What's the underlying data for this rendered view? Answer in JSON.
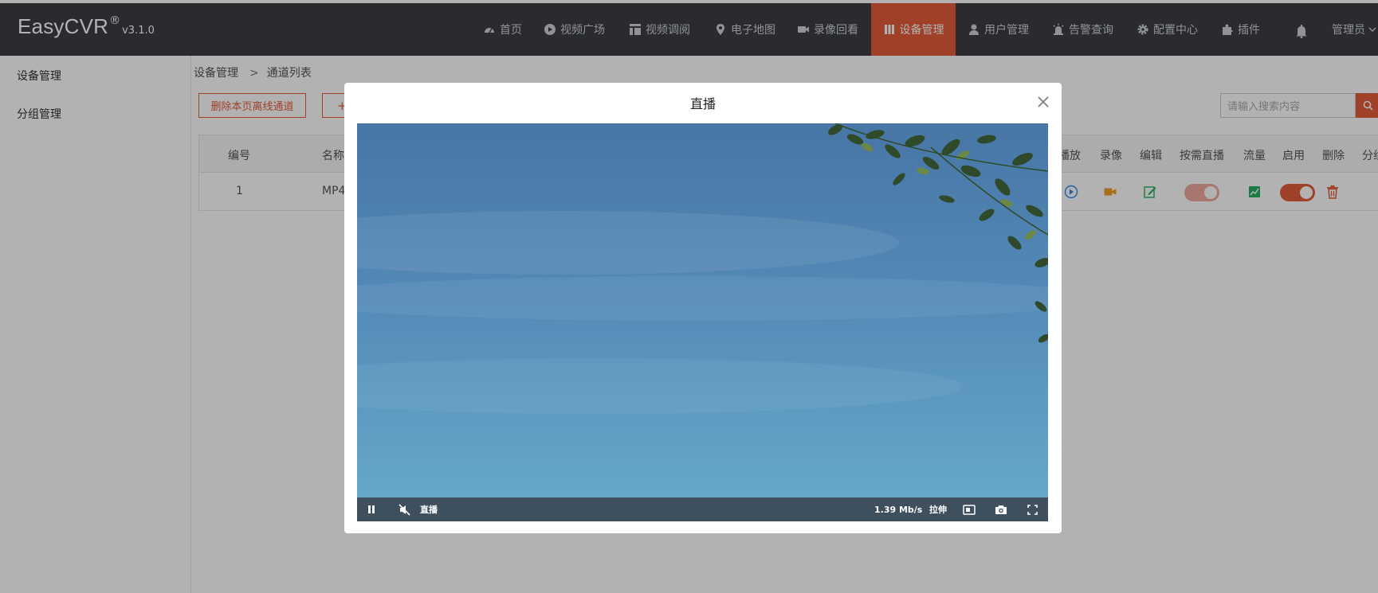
{
  "app": {
    "name": "EasyCVR",
    "registered": "®",
    "version": "v3.1.0"
  },
  "nav": {
    "items": [
      {
        "label": "首页",
        "icon": "dashboard-icon"
      },
      {
        "label": "视频广场",
        "icon": "play-circle-icon"
      },
      {
        "label": "视频调阅",
        "icon": "layout-icon"
      },
      {
        "label": "电子地图",
        "icon": "map-pin-icon"
      },
      {
        "label": "录像回看",
        "icon": "video-camera-icon"
      },
      {
        "label": "设备管理",
        "icon": "device-icon",
        "active": true
      },
      {
        "label": "用户管理",
        "icon": "user-icon"
      },
      {
        "label": "告警查询",
        "icon": "alarm-icon"
      },
      {
        "label": "配置中心",
        "icon": "gear-icon"
      },
      {
        "label": "插件",
        "icon": "puzzle-icon"
      }
    ],
    "user": "管理员"
  },
  "sidebar": {
    "items": [
      {
        "label": "设备管理"
      },
      {
        "label": "分组管理"
      }
    ]
  },
  "breadcrumb": {
    "root": "设备管理",
    "separator": ">",
    "current": "通道列表"
  },
  "toolbar": {
    "delete_offline_label": "删除本页离线通道",
    "add_label": "+",
    "search_placeholder": "请输入搜索内容"
  },
  "table": {
    "headers": [
      "编号",
      "名称",
      "播放",
      "录像",
      "编辑",
      "按需直播",
      "流量",
      "启用",
      "删除",
      "分组"
    ],
    "rows": [
      {
        "id": "1",
        "name": "MP4",
        "on_demand_live": false,
        "enabled": true
      }
    ]
  },
  "modal": {
    "title": "直播",
    "player": {
      "live_label": "直播",
      "bitrate": "1.39 Mb/s",
      "stretch_label": "拉伸",
      "muted": true
    }
  },
  "colors": {
    "accent": "#e45c3a",
    "topbar": "#3b3e42",
    "play": "#2d8cf0",
    "record": "#f0a020",
    "edit": "#27ae60",
    "stream": "#27ae60"
  }
}
